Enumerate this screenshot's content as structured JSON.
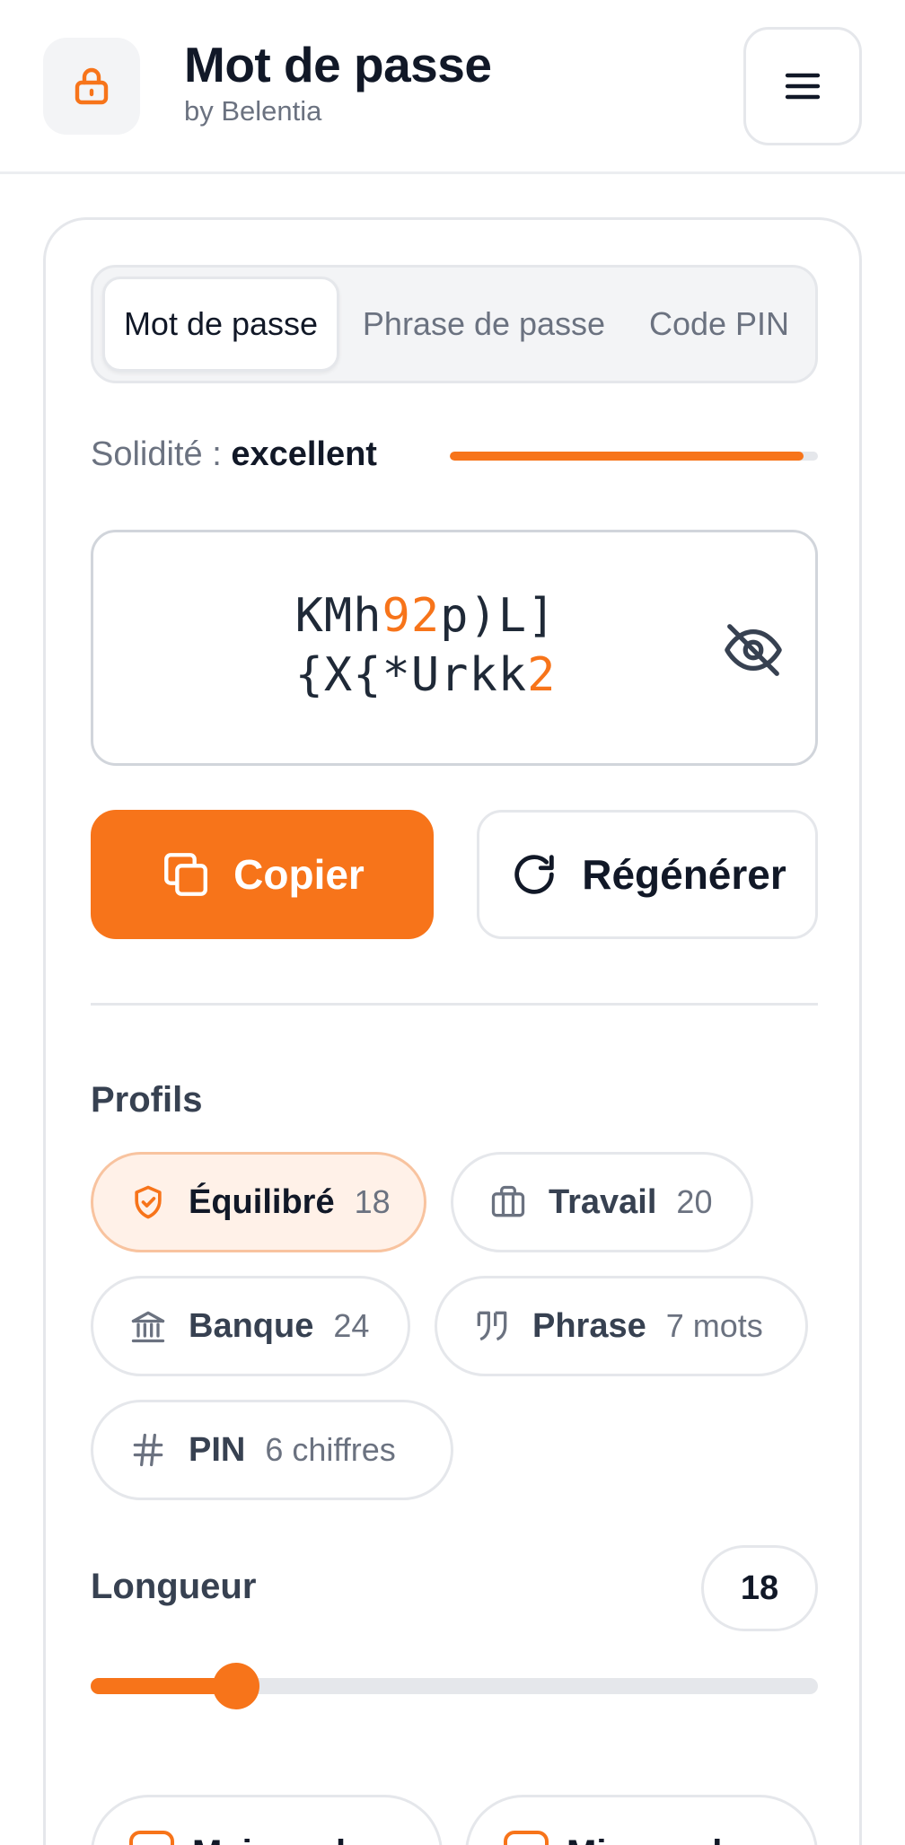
{
  "header": {
    "title": "Mot de passe",
    "subtitle": "by Belentia",
    "logo_icon": "lock-icon",
    "menu_icon": "menu-icon"
  },
  "tabs": [
    {
      "label": "Mot de passe",
      "active": true
    },
    {
      "label": "Phrase de passe",
      "active": false
    },
    {
      "label": "Code PIN",
      "active": false
    }
  ],
  "strength": {
    "label": "Solidité : ",
    "value": "excellent",
    "level": 0.96
  },
  "password": {
    "line1": [
      {
        "t": "KMh",
        "digit": false
      },
      {
        "t": "92",
        "digit": true
      },
      {
        "t": "p)L]",
        "digit": false
      }
    ],
    "line2": [
      {
        "t": "{X{*Urkk",
        "digit": false
      },
      {
        "t": "2",
        "digit": true
      }
    ],
    "visibility_icon": "eye-off-icon"
  },
  "actions": {
    "copy_label": "Copier",
    "regenerate_label": "Régénérer"
  },
  "profiles": {
    "label": "Profils",
    "items": [
      {
        "name": "Équilibré",
        "meta": "18",
        "icon": "shield-check-icon",
        "active": true
      },
      {
        "name": "Travail",
        "meta": "20",
        "icon": "briefcase-icon",
        "active": false
      },
      {
        "name": "Banque",
        "meta": "24",
        "icon": "bank-icon",
        "active": false
      },
      {
        "name": "Phrase",
        "meta": "7 mots",
        "icon": "quote-icon",
        "active": false
      },
      {
        "name": "PIN",
        "meta": "6 chiffres",
        "icon": "hash-icon",
        "active": false
      }
    ]
  },
  "length": {
    "label": "Longueur",
    "value": "18",
    "fraction": 0.2
  },
  "options": [
    {
      "label": "Majuscules",
      "checked": true
    },
    {
      "label": "Minuscules",
      "checked": true
    }
  ],
  "colors": {
    "accent": "#f7741a",
    "accent_soft": "#fff1e8",
    "text": "#111827",
    "muted": "#6b7280",
    "border": "#e5e7eb"
  }
}
